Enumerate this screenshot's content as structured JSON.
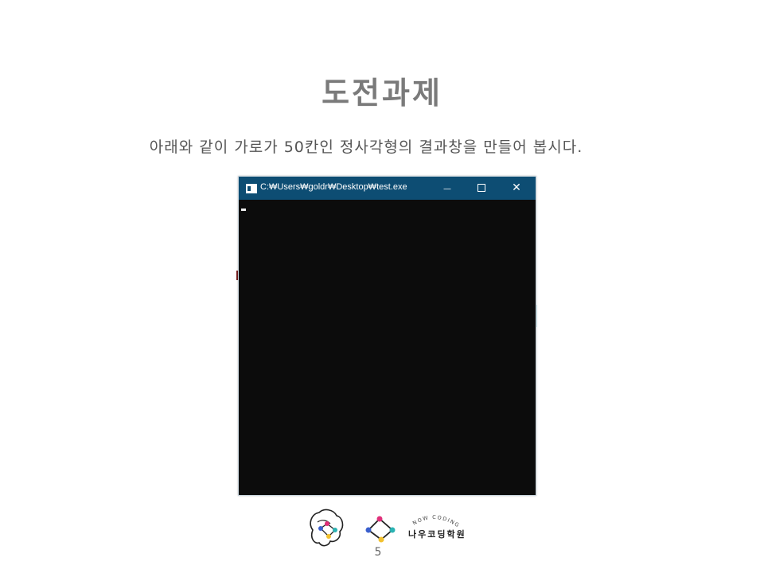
{
  "slide": {
    "title": "도전과제",
    "subtitle": "아래와 같이 가로가 50칸인 정사각형의 결과창을 만들어 봅시다.",
    "page_number": "5"
  },
  "console_window": {
    "title": "C:₩Users₩goldr₩Desktop₩test.exe",
    "minimize_glyph": "—",
    "close_glyph": "✕",
    "background_color": "#0c0c0c",
    "titlebar_color": "#0d4d73"
  },
  "logo": {
    "brand_korean": "나우코딩학원",
    "brand_english": "NOW CODING"
  },
  "colors": {
    "title": "#7a7a7a",
    "accent_teal": "#2bb3b3",
    "accent_pink": "#e0307a",
    "accent_yellow": "#f2c12e",
    "accent_blue": "#3a5fcd"
  }
}
